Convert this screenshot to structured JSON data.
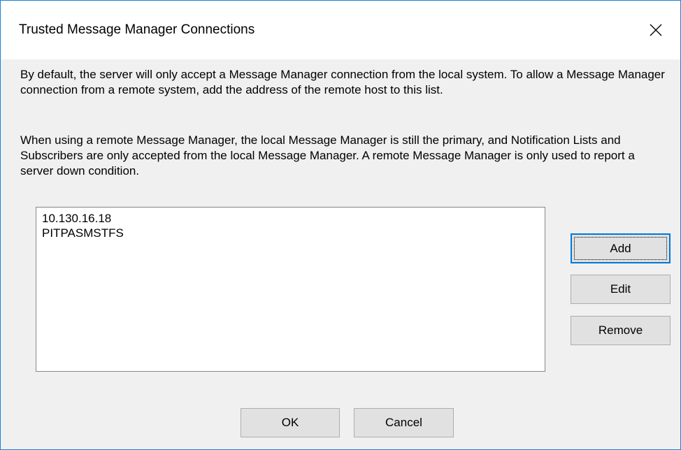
{
  "window": {
    "title": "Trusted Message Manager Connections",
    "close_icon": "close-icon",
    "accent_color": "#1883d7"
  },
  "description": {
    "paragraph1": "By default, the server will only accept a Message Manager connection from the local system. To allow a Message Manager connection from a remote system, add the address of the remote host to this list.",
    "paragraph2": "When using a remote Message Manager, the local Message Manager is still the primary, and Notification Lists and Subscribers are only accepted from the local Message Manager.  A remote Message Manager is only used to report a server down condition."
  },
  "hosts_list": {
    "items": [
      "10.130.16.18",
      "PITPASMSTFS"
    ]
  },
  "side_buttons": {
    "add_label": "Add",
    "edit_label": "Edit",
    "remove_label": "Remove"
  },
  "footer_buttons": {
    "ok_label": "OK",
    "cancel_label": "Cancel"
  }
}
